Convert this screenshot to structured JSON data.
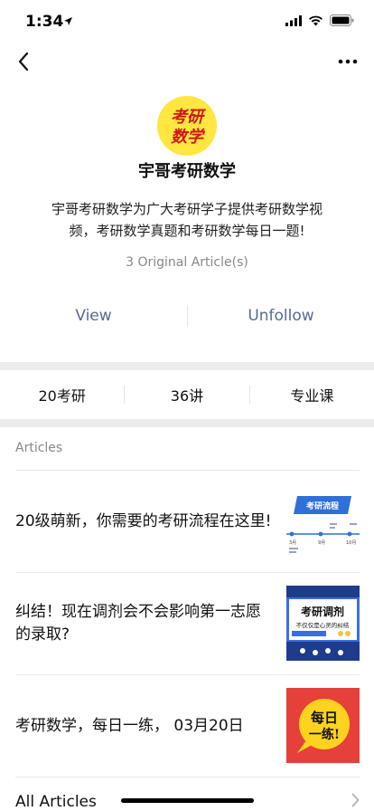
{
  "status": {
    "time": "1:34"
  },
  "account": {
    "avatar_text_line1": "考研",
    "avatar_text_line2": "数学",
    "name": "宇哥考研数学",
    "description": "宇哥考研数学为广大考研学子提供考研数学视频，考研数学真题和考研数学每日一题!",
    "article_count": "3 Original Article(s)"
  },
  "actions": {
    "view": "View",
    "unfollow": "Unfollow"
  },
  "menu": [
    {
      "label": "20考研"
    },
    {
      "label": "36讲"
    },
    {
      "label": "专业课"
    }
  ],
  "articles_heading": "Articles",
  "articles": [
    {
      "title": "20级萌新，你需要的考研流程在这里!",
      "thumb": {
        "banner": "考研流程",
        "t1": "3月",
        "t2": "9月",
        "t3": "10月"
      }
    },
    {
      "title": "纠结！现在调剂会不会影响第一志愿的录取?",
      "thumb": {
        "headline": "考研调剂",
        "sub": "不仅仅是心灵的纠结"
      }
    },
    {
      "title": "考研数学，每日一练， 03月20日",
      "thumb": {
        "line1": "每日",
        "line2": "一练!"
      }
    }
  ],
  "all_articles": "All Articles",
  "colors": {
    "link": "#576b95",
    "avatar_bg": "#ffe640",
    "avatar_text": "#d0161a",
    "separator": "#ececec"
  }
}
